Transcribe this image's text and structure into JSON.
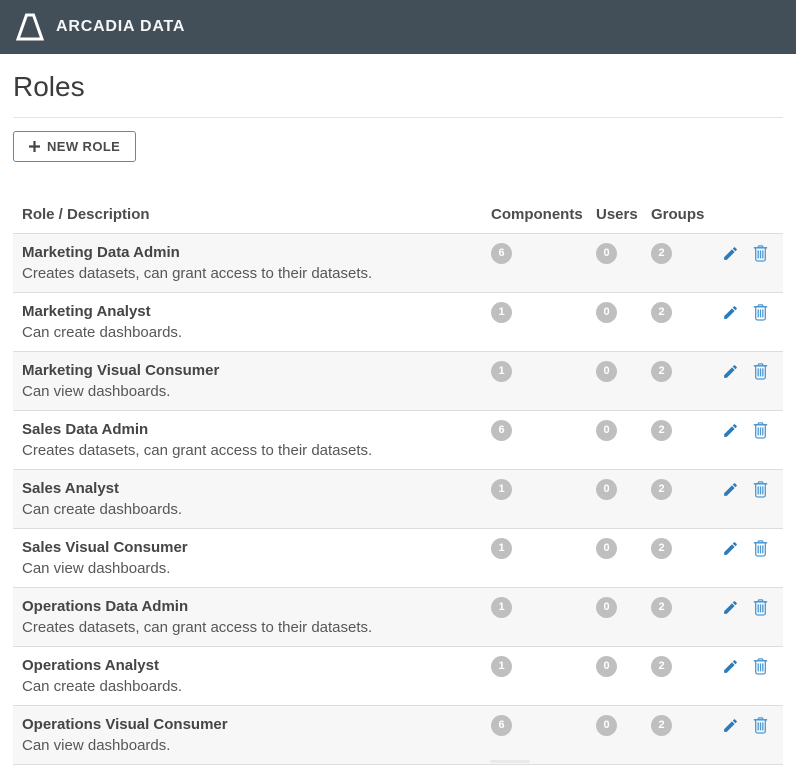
{
  "topbar": {
    "brand": "ARCADIA DATA"
  },
  "page": {
    "title": "Roles"
  },
  "toolbar": {
    "new_role_label": "NEW ROLE"
  },
  "table": {
    "columns": {
      "role": "Role / Description",
      "components": "Components",
      "users": "Users",
      "groups": "Groups"
    },
    "rows": [
      {
        "name": "Marketing Data Admin",
        "description": "Creates datasets, can grant access to their datasets.",
        "components": "6",
        "users": "0",
        "groups": "2"
      },
      {
        "name": "Marketing Analyst",
        "description": "Can create dashboards.",
        "components": "1",
        "users": "0",
        "groups": "2"
      },
      {
        "name": "Marketing Visual Consumer",
        "description": "Can view dashboards.",
        "components": "1",
        "users": "0",
        "groups": "2"
      },
      {
        "name": "Sales Data Admin",
        "description": "Creates datasets, can grant access to their datasets.",
        "components": "6",
        "users": "0",
        "groups": "2"
      },
      {
        "name": "Sales Analyst",
        "description": "Can create dashboards.",
        "components": "1",
        "users": "0",
        "groups": "2"
      },
      {
        "name": "Sales Visual Consumer",
        "description": "Can view dashboards.",
        "components": "1",
        "users": "0",
        "groups": "2"
      },
      {
        "name": "Operations Data Admin",
        "description": "Creates datasets, can grant access to their datasets.",
        "components": "1",
        "users": "0",
        "groups": "2"
      },
      {
        "name": "Operations Analyst",
        "description": "Can create dashboards.",
        "components": "1",
        "users": "0",
        "groups": "2"
      },
      {
        "name": "Operations Visual Consumer",
        "description": "Can view dashboards.",
        "components": "6",
        "users": "0",
        "groups": "2"
      }
    ]
  },
  "colors": {
    "topbar_bg": "#424e58",
    "button_border": "#4a90c8",
    "edit_icon": "#2e7bb9",
    "delete_icon": "#4e98d2",
    "badge_bg": "#bfbfbf",
    "row_alt_bg": "#f7f7f7"
  }
}
